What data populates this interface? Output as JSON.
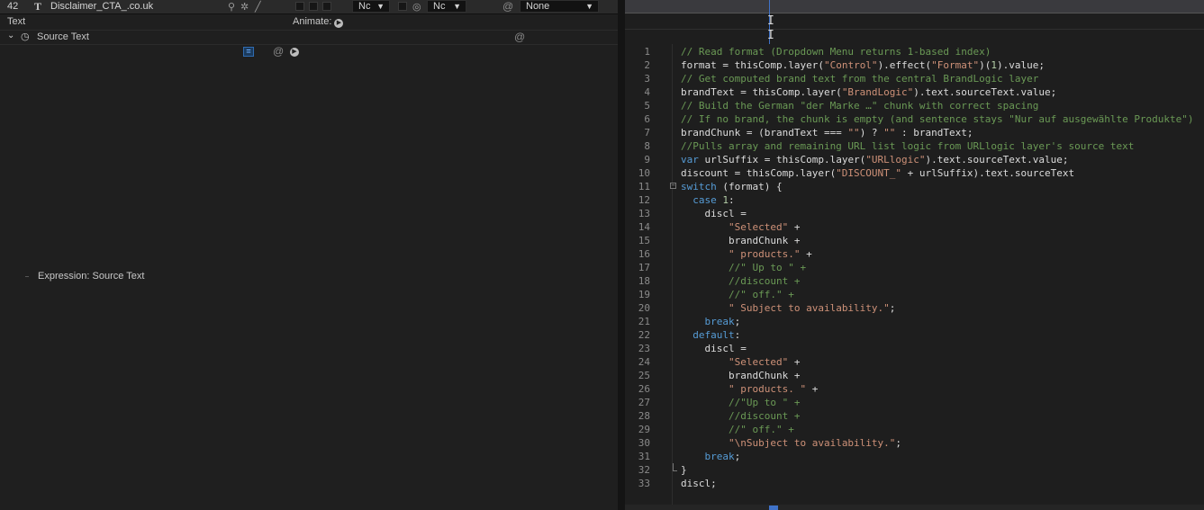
{
  "layer": {
    "number": "42",
    "type_glyph": "T",
    "name": "Disclaimer_CTA_.co.uk",
    "mode_dropdown": "Nc",
    "trkmat_dropdown": "Nc",
    "parent_dropdown": "None"
  },
  "text_group": {
    "label": "Text",
    "animate_label": "Animate:"
  },
  "source_text": {
    "label": "Source Text",
    "expression_label": "Expression: Source Text"
  },
  "code": {
    "lines": [
      [
        [
          "com",
          "// Read format (Dropdown Menu returns 1-based index)"
        ]
      ],
      [
        [
          "def",
          "format = thisComp.layer("
        ],
        [
          "str",
          "\"Control\""
        ],
        [
          "def",
          ").effect("
        ],
        [
          "str",
          "\"Format\""
        ],
        [
          "def",
          ")("
        ],
        [
          "num",
          "1"
        ],
        [
          "def",
          ").value;"
        ]
      ],
      [
        [
          "com",
          "// Get computed brand text from the central BrandLogic layer"
        ]
      ],
      [
        [
          "def",
          "brandText = thisComp.layer("
        ],
        [
          "str",
          "\"BrandLogic\""
        ],
        [
          "def",
          ").text.sourceText.value;"
        ]
      ],
      [
        [
          "com",
          "// Build the German \"der Marke …\" chunk with correct spacing"
        ]
      ],
      [
        [
          "com",
          "// If no brand, the chunk is empty (and sentence stays \"Nur auf ausgewählte Produkte\")"
        ]
      ],
      [
        [
          "def",
          "brandChunk = (brandText === "
        ],
        [
          "str",
          "\"\""
        ],
        [
          "def",
          ") ? "
        ],
        [
          "str",
          "\"\""
        ],
        [
          "def",
          " : brandText;"
        ]
      ],
      [
        [
          "com",
          "//Pulls array and remaining URL list logic from URLlogic layer's source text"
        ]
      ],
      [
        [
          "kw",
          "var"
        ],
        [
          "def",
          " urlSuffix = thisComp.layer("
        ],
        [
          "str",
          "\"URLlogic\""
        ],
        [
          "def",
          ").text.sourceText.value;"
        ]
      ],
      [
        [
          "def",
          "discount = thisComp.layer("
        ],
        [
          "str",
          "\"DISCOUNT_\""
        ],
        [
          "def",
          " + urlSuffix).text.sourceText"
        ]
      ],
      [
        [
          "kw",
          "switch"
        ],
        [
          "def",
          " (format) {"
        ]
      ],
      [
        [
          "def",
          "  "
        ],
        [
          "kw",
          "case"
        ],
        [
          "def",
          " "
        ],
        [
          "num",
          "1"
        ],
        [
          "def",
          ":"
        ]
      ],
      [
        [
          "def",
          "    discl ="
        ]
      ],
      [
        [
          "def",
          "        "
        ],
        [
          "str",
          "\"Selected\""
        ],
        [
          "def",
          " +"
        ]
      ],
      [
        [
          "def",
          "        brandChunk +"
        ]
      ],
      [
        [
          "def",
          "        "
        ],
        [
          "str",
          "\" products.\""
        ],
        [
          "def",
          " +"
        ]
      ],
      [
        [
          "def",
          "        "
        ],
        [
          "com",
          "//\" Up to \" +"
        ]
      ],
      [
        [
          "def",
          "        "
        ],
        [
          "com",
          "//discount +"
        ]
      ],
      [
        [
          "def",
          "        "
        ],
        [
          "com",
          "//\" off.\" +"
        ]
      ],
      [
        [
          "def",
          "        "
        ],
        [
          "str",
          "\" Subject to availability.\""
        ],
        [
          "def",
          ";"
        ]
      ],
      [
        [
          "def",
          "    "
        ],
        [
          "kw",
          "break"
        ],
        [
          "def",
          ";"
        ]
      ],
      [
        [
          "def",
          "  "
        ],
        [
          "kw",
          "default"
        ],
        [
          "def",
          ":"
        ]
      ],
      [
        [
          "def",
          "    discl ="
        ]
      ],
      [
        [
          "def",
          "        "
        ],
        [
          "str",
          "\"Selected\""
        ],
        [
          "def",
          " +"
        ]
      ],
      [
        [
          "def",
          "        brandChunk +"
        ]
      ],
      [
        [
          "def",
          "        "
        ],
        [
          "str",
          "\" products. \""
        ],
        [
          "def",
          " +"
        ]
      ],
      [
        [
          "def",
          "        "
        ],
        [
          "com",
          "//\"Up to \" +"
        ]
      ],
      [
        [
          "def",
          "        "
        ],
        [
          "com",
          "//discount +"
        ]
      ],
      [
        [
          "def",
          "        "
        ],
        [
          "com",
          "//\" off.\" +"
        ]
      ],
      [
        [
          "def",
          "        "
        ],
        [
          "str",
          "\"\\nSubject to availability.\""
        ],
        [
          "def",
          ";"
        ]
      ],
      [
        [
          "def",
          "    "
        ],
        [
          "kw",
          "break"
        ],
        [
          "def",
          ";"
        ]
      ],
      [
        [
          "def",
          "}"
        ]
      ],
      [
        [
          "def",
          "discl;"
        ]
      ]
    ]
  },
  "colors": {
    "comment": "#6a9955",
    "string": "#ce9178",
    "keyword": "#569cd6",
    "number": "#b5cea8",
    "default": "#dcdcdc",
    "time_indicator": "#3f72c8"
  }
}
